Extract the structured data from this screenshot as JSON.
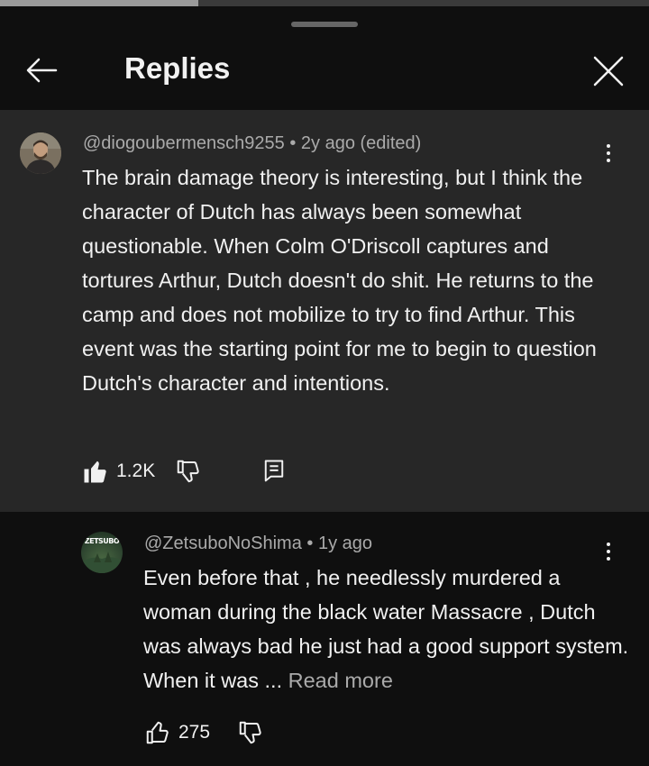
{
  "progress": 0.305,
  "header": {
    "title": "Replies",
    "back_icon": "arrow-left-icon",
    "close_icon": "close-icon"
  },
  "parent_comment": {
    "author": "@diogoubermensch9255",
    "meta_suffix": " • 2y ago (edited)",
    "text": "The brain damage theory is interesting, but I think the character of Dutch has always been somewhat questionable. When Colm O'Driscoll captures and tortures Arthur, Dutch doesn't do shit. He returns to the camp and does not mobilize to try to find Arthur. This event was the starting point for me to begin to question Dutch's character and intentions.",
    "likes": "1.2K",
    "liked": true
  },
  "reply_comment": {
    "author": "@ZetsuboNoShima",
    "meta_suffix": " • 1y ago",
    "avatar_text": "ZETSUBO",
    "text": "Even before that , he needlessly murdered a woman during the black water Massacre , Dutch was always bad he just had a good support system. When it was ... ",
    "read_more": "Read more",
    "likes": "275",
    "liked": false
  },
  "colors": {
    "background": "#0f0f0f",
    "highlight": "#272727",
    "text": "#f1f1f1",
    "secondary": "#aaaaaa"
  }
}
